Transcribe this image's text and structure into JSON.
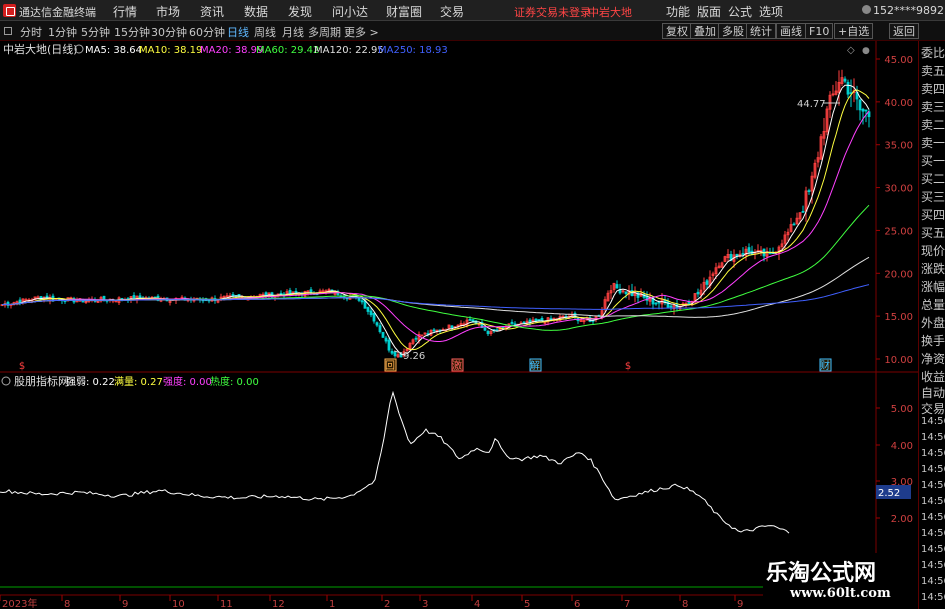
{
  "menubar": {
    "app_title": "通达信金融终端",
    "items": [
      "行情",
      "市场",
      "资讯",
      "数据",
      "发现",
      "问小达",
      "财富圈",
      "交易"
    ],
    "warning": "证券交易未登录",
    "stock": "中岩大地",
    "right_items": [
      "功能",
      "版面",
      "公式",
      "选项"
    ],
    "user": "152****9892",
    "window_buttons": [
      "—",
      "□",
      "✕"
    ]
  },
  "periods": [
    "分时",
    "1分钟",
    "5分钟",
    "15分钟",
    "30分钟",
    "60分钟",
    "日线",
    "周线",
    "月线",
    "多周期",
    "更多 >"
  ],
  "active_period": "日线",
  "toolbar": [
    "复权",
    "叠加",
    "多股",
    "统计",
    "画线",
    "F10",
    "+自选",
    "返回"
  ],
  "main": {
    "title": "中岩大地(日线)",
    "ma": [
      {
        "label": "MA5: 38.64",
        "color": "#ffffff"
      },
      {
        "label": "MA10: 38.19",
        "color": "#ffff40"
      },
      {
        "label": "MA20: 38.99",
        "color": "#ff40ff"
      },
      {
        "label": "MA60: 29.42",
        "color": "#40ff40"
      },
      {
        "label": "MA120: 22.95",
        "color": "#e0e0e0"
      },
      {
        "label": "MA250: 18.93",
        "color": "#4060ff"
      }
    ],
    "y_labels": [
      "45.00",
      "40.00",
      "35.00",
      "30.00",
      "25.00",
      "20.00",
      "15.00",
      "10.00"
    ],
    "y_values": [
      45,
      40,
      35,
      30,
      25,
      20,
      15,
      10
    ],
    "high_label": "44.77",
    "low_label": "9.26",
    "event_marks": [
      "$",
      "回",
      "激",
      "解",
      "$",
      "财"
    ]
  },
  "sub": {
    "title": "股朋指标网",
    "indicators": [
      {
        "label": "强弱: 0.22",
        "color": "#ffffff"
      },
      {
        "label": "满量: 0.27",
        "color": "#ffff40"
      },
      {
        "label": "强度: 0.00",
        "color": "#ff40ff"
      },
      {
        "label": "热度: 0.00",
        "color": "#40ff40"
      }
    ],
    "y_labels": [
      "5.00",
      "4.00",
      "3.00",
      "2.00"
    ],
    "y_values": [
      5,
      4,
      3,
      2
    ],
    "current_value": "2.52"
  },
  "x_labels": [
    "2023年",
    "8",
    "9",
    "10",
    "11",
    "12",
    "1",
    "2",
    "3",
    "4",
    "5",
    "6",
    "7",
    "8",
    "9"
  ],
  "sidebar": {
    "top": [
      "委比",
      "卖五",
      "卖四",
      "卖三",
      "卖二",
      "卖一",
      "买一",
      "买二",
      "买三",
      "买四",
      "买五",
      "现价",
      "涨跌",
      "涨幅",
      "总量",
      "外盘",
      "换手",
      "净资",
      "收益"
    ],
    "bottom": [
      "自动",
      "交易",
      "14:56",
      "14:56",
      "14:56",
      "14:56",
      "14:56",
      "14:56",
      "14:56",
      "14:56",
      "14:56",
      "14:56",
      "14:56",
      "14:56"
    ]
  },
  "watermark": {
    "name": "乐淘公式网",
    "url": "www.60lt.com"
  }
}
